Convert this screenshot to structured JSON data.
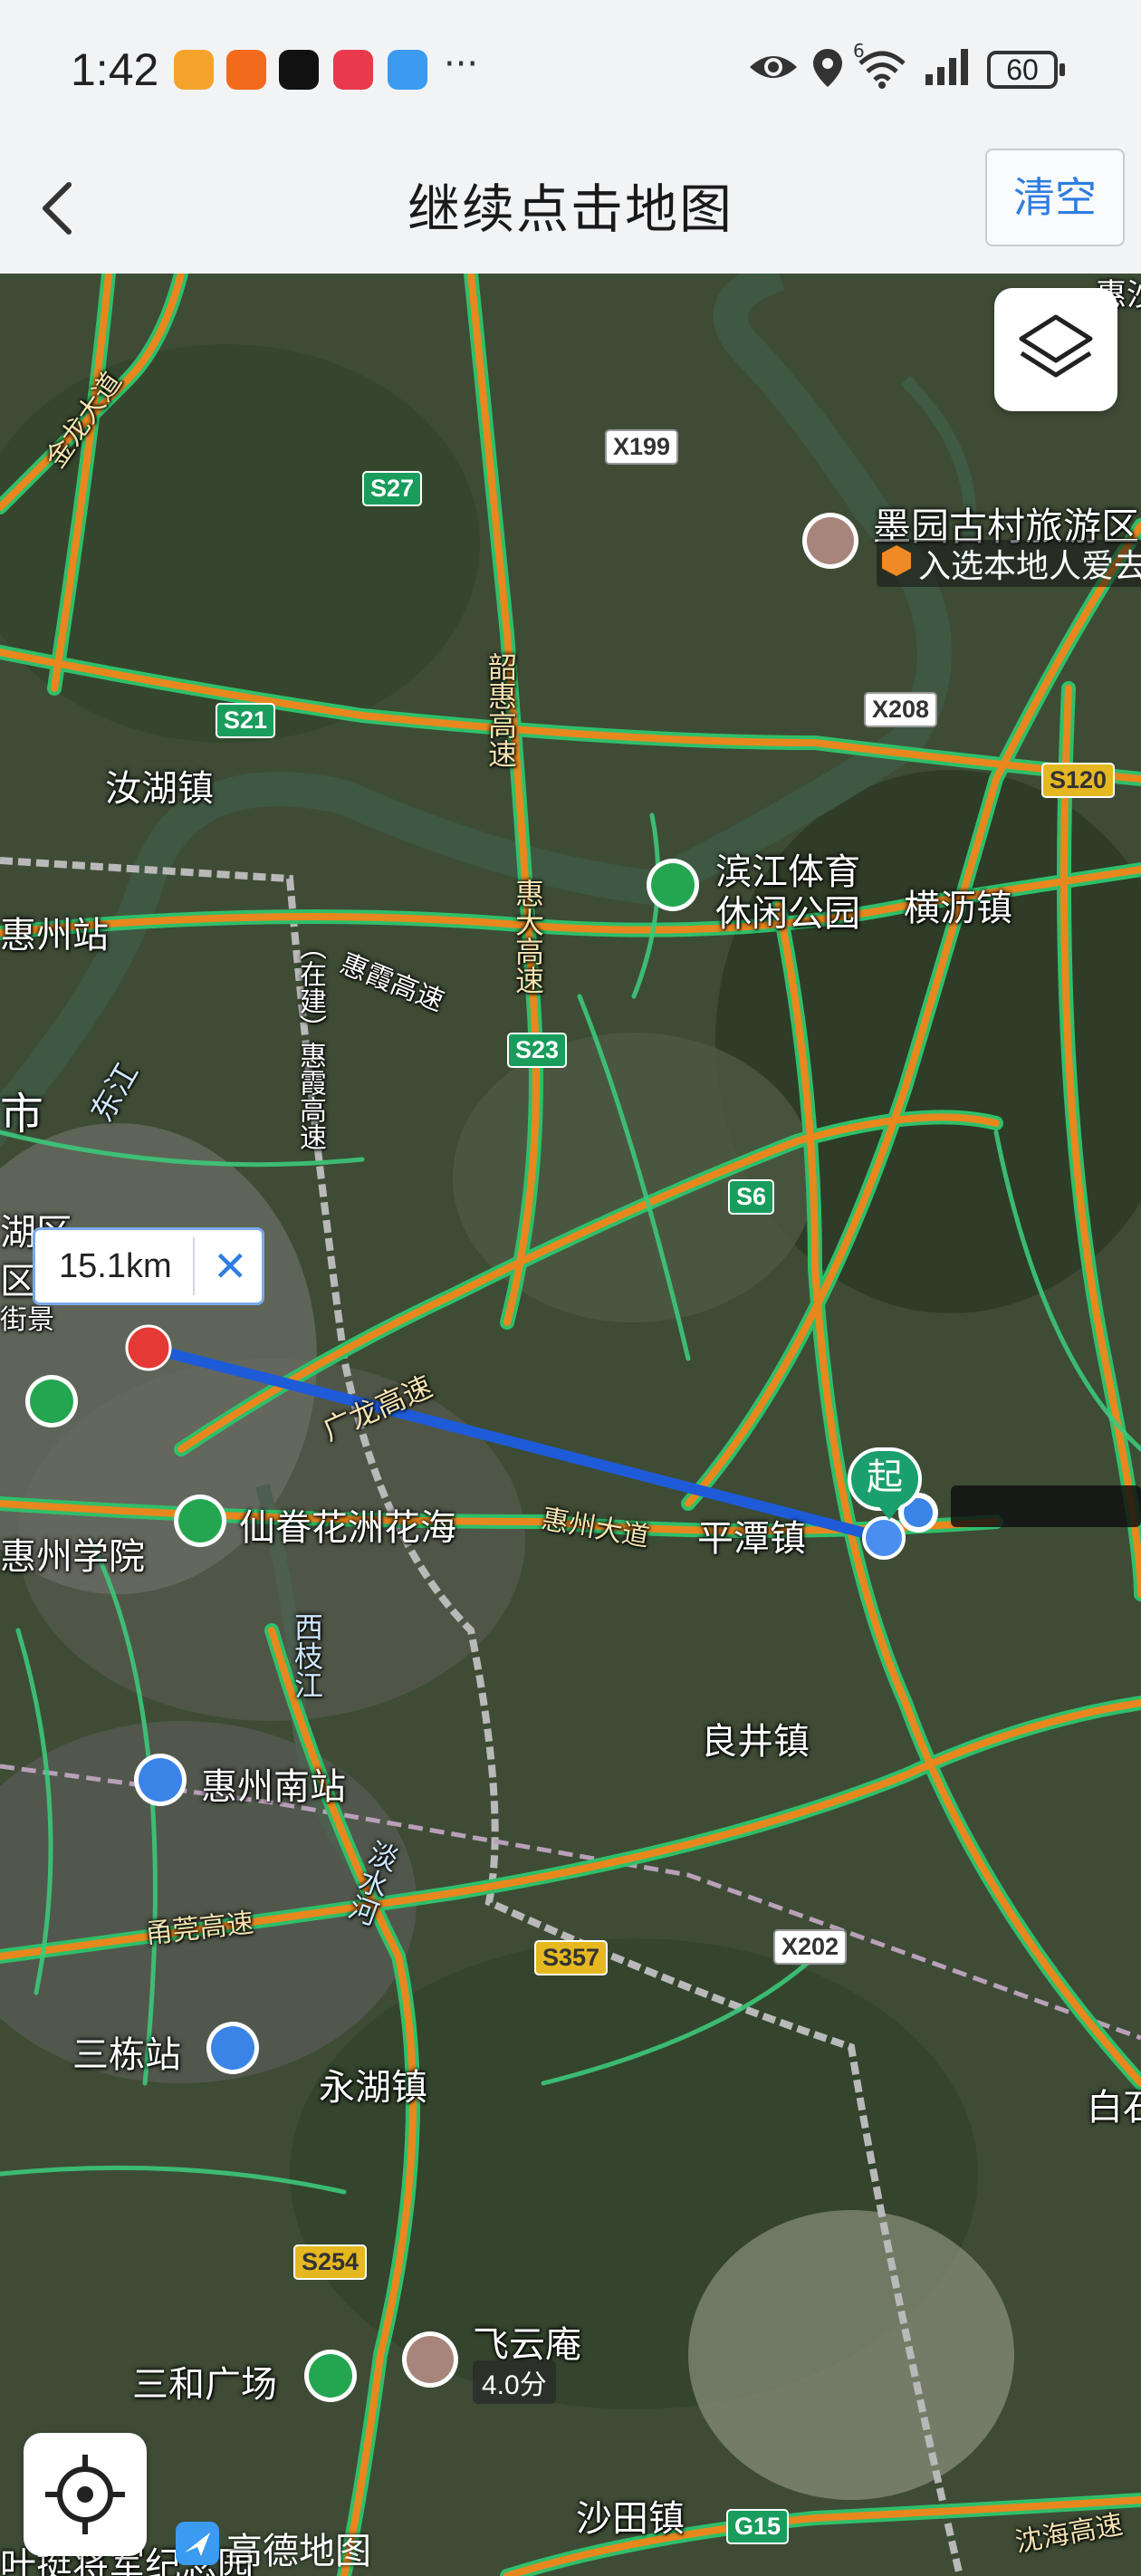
{
  "status_bar": {
    "time": "1:42",
    "overflow": "···",
    "battery": "60",
    "signal_label": "6",
    "app_icon_colors": [
      "#f4a42c",
      "#f26a1b",
      "#111111",
      "#e8394d",
      "#3a9bf0"
    ]
  },
  "header": {
    "title": "继续点击地图",
    "clear_label": "清空"
  },
  "measure": {
    "distance": "15.1km",
    "close": "✕",
    "start_marker": "起"
  },
  "map_labels": {
    "place_1": "墨园古村旅游区",
    "place_1_tag": "入选本地人爱去榜",
    "place_2": "汝湖镇",
    "place_3": "滨江体育",
    "place_3b": "休闲公园",
    "place_4": "横沥镇",
    "place_5": "惠州站",
    "place_6": "市",
    "place_7": "湖区",
    "place_8": "区",
    "place_9": "街景",
    "place_10": "仙眷花洲花海",
    "place_11": "平潭镇",
    "place_12": "惠州学院",
    "place_13": "惠州南站",
    "place_14": "良井镇",
    "place_15": "三栋站",
    "place_16": "永湖镇",
    "place_17": "白石",
    "place_18": "飞云庵",
    "place_18_rating": "4.0分",
    "place_19": "三和广场",
    "place_20": "沙田镇",
    "place_21": "叶挺将军纪念园",
    "place_22": "惠沙",
    "highway_1": "韶惠高速",
    "highway_2": "惠大高速",
    "highway_3": "惠霞高速",
    "highway_4": "（在建）惠霞高速",
    "highway_5": "广龙高速",
    "highway_6": "惠州大道",
    "highway_7": "甬莞高速",
    "highway_8": "沈海高速",
    "river_1": "东江",
    "river_2": "西枝江",
    "river_3": "淡水河",
    "highway_9": "金龙大道"
  },
  "road_shields": {
    "s27": "S27",
    "s21": "S21",
    "s23": "S23",
    "s6": "S6",
    "s120": "S120",
    "s357": "S357",
    "s254": "S254",
    "g15": "G15",
    "x199": "X199",
    "x208": "X208",
    "x202": "X202"
  },
  "brand": {
    "logo_text": "高德地图"
  },
  "colors": {
    "route_blue": "#1e5bd8",
    "accent_blue": "#2e7de1",
    "start_green": "#1a9f6e",
    "end_red": "#e53935",
    "highway_orange": "#e8871e",
    "highway_green": "#2fbf6a"
  },
  "icons": {
    "back": "chevron-left-icon",
    "layers": "layers-icon",
    "locate": "crosshair-icon"
  }
}
